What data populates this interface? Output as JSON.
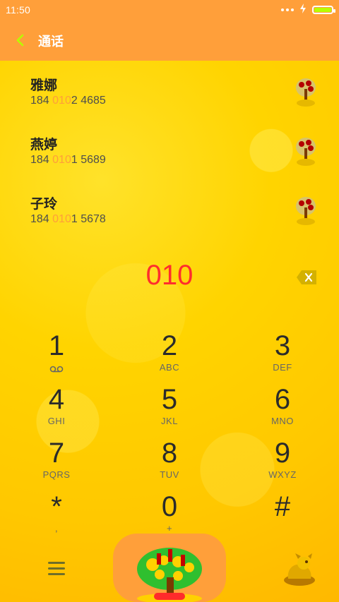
{
  "status": {
    "time": "11:50"
  },
  "header": {
    "title": "通话",
    "back_icon": "chevron-left-icon"
  },
  "contacts": [
    {
      "name": "雅娜",
      "number_prefix": "184 ",
      "number_match": "010",
      "number_suffix": "2 4685",
      "avatar_icon": "money-tree-icon"
    },
    {
      "name": "燕婷",
      "number_prefix": "184 ",
      "number_match": "010",
      "number_suffix": "1 5689",
      "avatar_icon": "money-tree-icon"
    },
    {
      "name": "子玲",
      "number_prefix": "184 ",
      "number_match": "010",
      "number_suffix": "1 5678",
      "avatar_icon": "money-tree-icon"
    }
  ],
  "dialer": {
    "input": "010",
    "backspace_icon": "backspace-icon"
  },
  "keypad": [
    {
      "digit": "1",
      "letters": "",
      "icon": "voicemail-icon"
    },
    {
      "digit": "2",
      "letters": "ABC"
    },
    {
      "digit": "3",
      "letters": "DEF"
    },
    {
      "digit": "4",
      "letters": "GHI"
    },
    {
      "digit": "5",
      "letters": "JKL"
    },
    {
      "digit": "6",
      "letters": "MNO"
    },
    {
      "digit": "7",
      "letters": "PQRS"
    },
    {
      "digit": "8",
      "letters": "TUV"
    },
    {
      "digit": "9",
      "letters": "WXYZ"
    },
    {
      "digit": "*",
      "letters": ","
    },
    {
      "digit": "0",
      "letters": "+"
    },
    {
      "digit": "#",
      "letters": ""
    }
  ],
  "bottom": {
    "menu_icon": "menu-icon",
    "call_icon": "money-tree-call-icon",
    "right_icon": "golden-dragon-icon"
  },
  "colors": {
    "bar": "#ff9f3a",
    "highlight": "#ff9f3a",
    "dialed_text": "#ff2d2d",
    "background": "#ffd400"
  }
}
